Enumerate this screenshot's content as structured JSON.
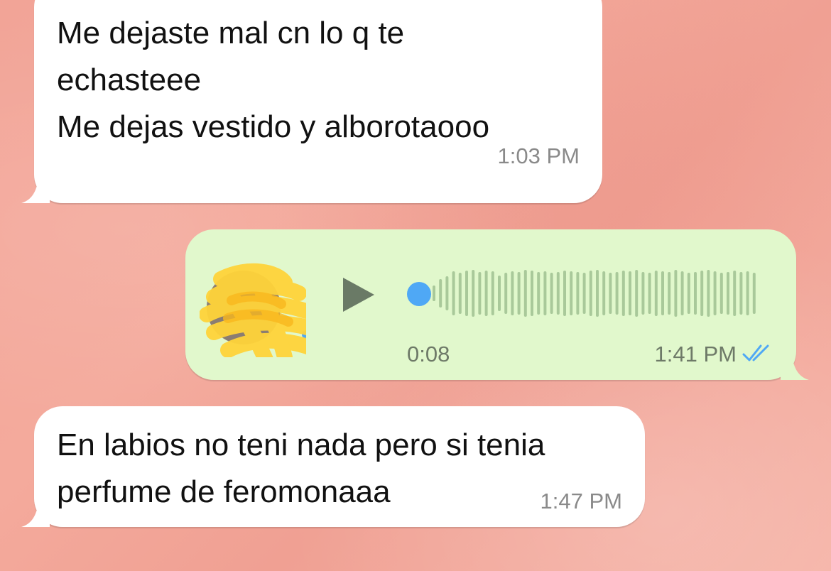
{
  "messages": [
    {
      "direction": "incoming",
      "text": "Me dejaste mal cn lo q te\nechasteee\nMe dejas vestido y alborotaooo",
      "time": "1:03 PM"
    },
    {
      "direction": "outgoing",
      "type": "voice",
      "duration": "0:08",
      "time": "1:41 PM",
      "status": "read",
      "status_icon": "double-check-icon",
      "play_icon": "play-icon",
      "progress": 0.0
    },
    {
      "direction": "incoming",
      "text": "En labios no teni nada pero si tenia\nperfume de feromonaaa",
      "time": "1:47 PM"
    }
  ],
  "colors": {
    "background": "#f2a497",
    "incoming_bubble": "#ffffff",
    "outgoing_bubble": "#e1f8cc",
    "read_ticks": "#4fa8f5",
    "progress_dot": "#4fa8f5",
    "waveform": "#a9c99a",
    "play_icon": "#6a7a66"
  }
}
